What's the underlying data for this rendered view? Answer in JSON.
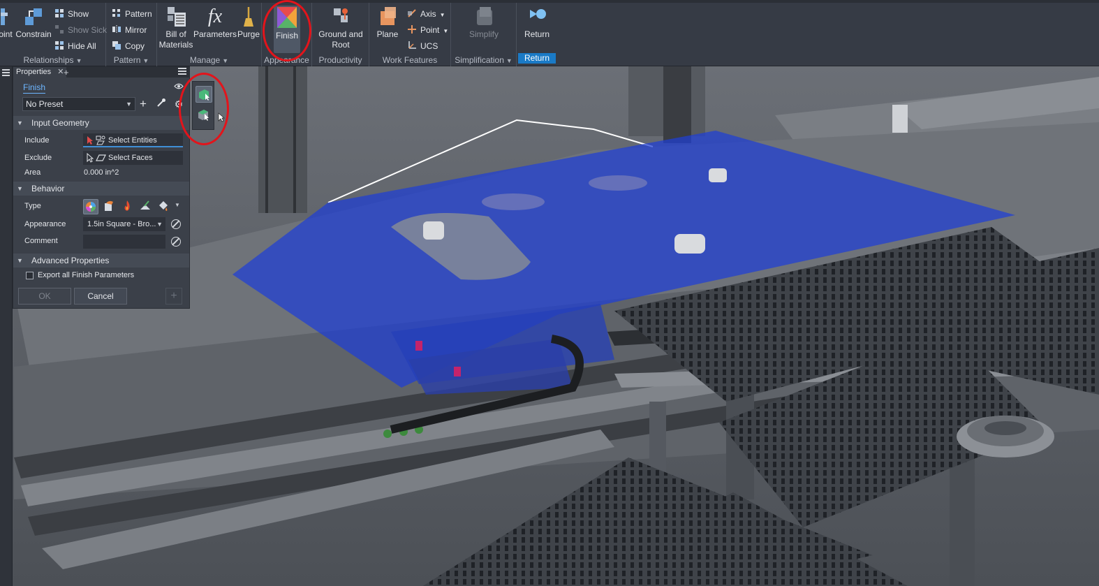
{
  "ribbon": {
    "relationships": {
      "point_label": "oint",
      "constrain_label": "Constrain",
      "show_label": "Show",
      "show_sick_label": "Show Sick",
      "hide_all_label": "Hide All",
      "group_label": "Relationships"
    },
    "pattern": {
      "pattern_label": "Pattern",
      "mirror_label": "Mirror",
      "copy_label": "Copy",
      "group_label": "Pattern"
    },
    "manage": {
      "bom_line1": "Bill of",
      "bom_line2": "Materials",
      "parameters_label": "Parameters",
      "parameters_glyph": "fx",
      "purge_label": "Purge",
      "group_label": "Manage"
    },
    "appearance": {
      "finish_label": "Finish",
      "group_label": "Appearance"
    },
    "productivity": {
      "ground_line1": "Ground and",
      "ground_line2": "Root",
      "group_label": "Productivity"
    },
    "work_features": {
      "plane_label": "Plane",
      "axis_label": "Axis",
      "point_label": "Point",
      "ucs_label": "UCS",
      "group_label": "Work Features"
    },
    "simplification": {
      "simplify_label": "Simplify",
      "group_label": "Simplification"
    },
    "return": {
      "return_label": "Return",
      "group_label": "Return"
    }
  },
  "panel": {
    "tab_title": "Properties",
    "close_glyph": "✕",
    "add_glyph": "+",
    "finish_link": "Finish",
    "preset": "No Preset",
    "sections": {
      "input_geometry": "Input Geometry",
      "behavior": "Behavior",
      "advanced": "Advanced Properties"
    },
    "include_label": "Include",
    "include_value": "Select Entities",
    "exclude_label": "Exclude",
    "exclude_value": "Select Faces",
    "area_label": "Area",
    "area_value": "0.000 in^2",
    "type_label": "Type",
    "appearance_label": "Appearance",
    "appearance_value": "1.5in Square - Bro...",
    "comment_label": "Comment",
    "comment_value": "",
    "export_label": "Export all Finish Parameters",
    "export_checked": false,
    "ok_label": "OK",
    "cancel_label": "Cancel"
  },
  "colors": {
    "accent": "#1a7ac6",
    "highlight_ring": "#e3141b",
    "selection_blue": "#1f3fd6"
  }
}
